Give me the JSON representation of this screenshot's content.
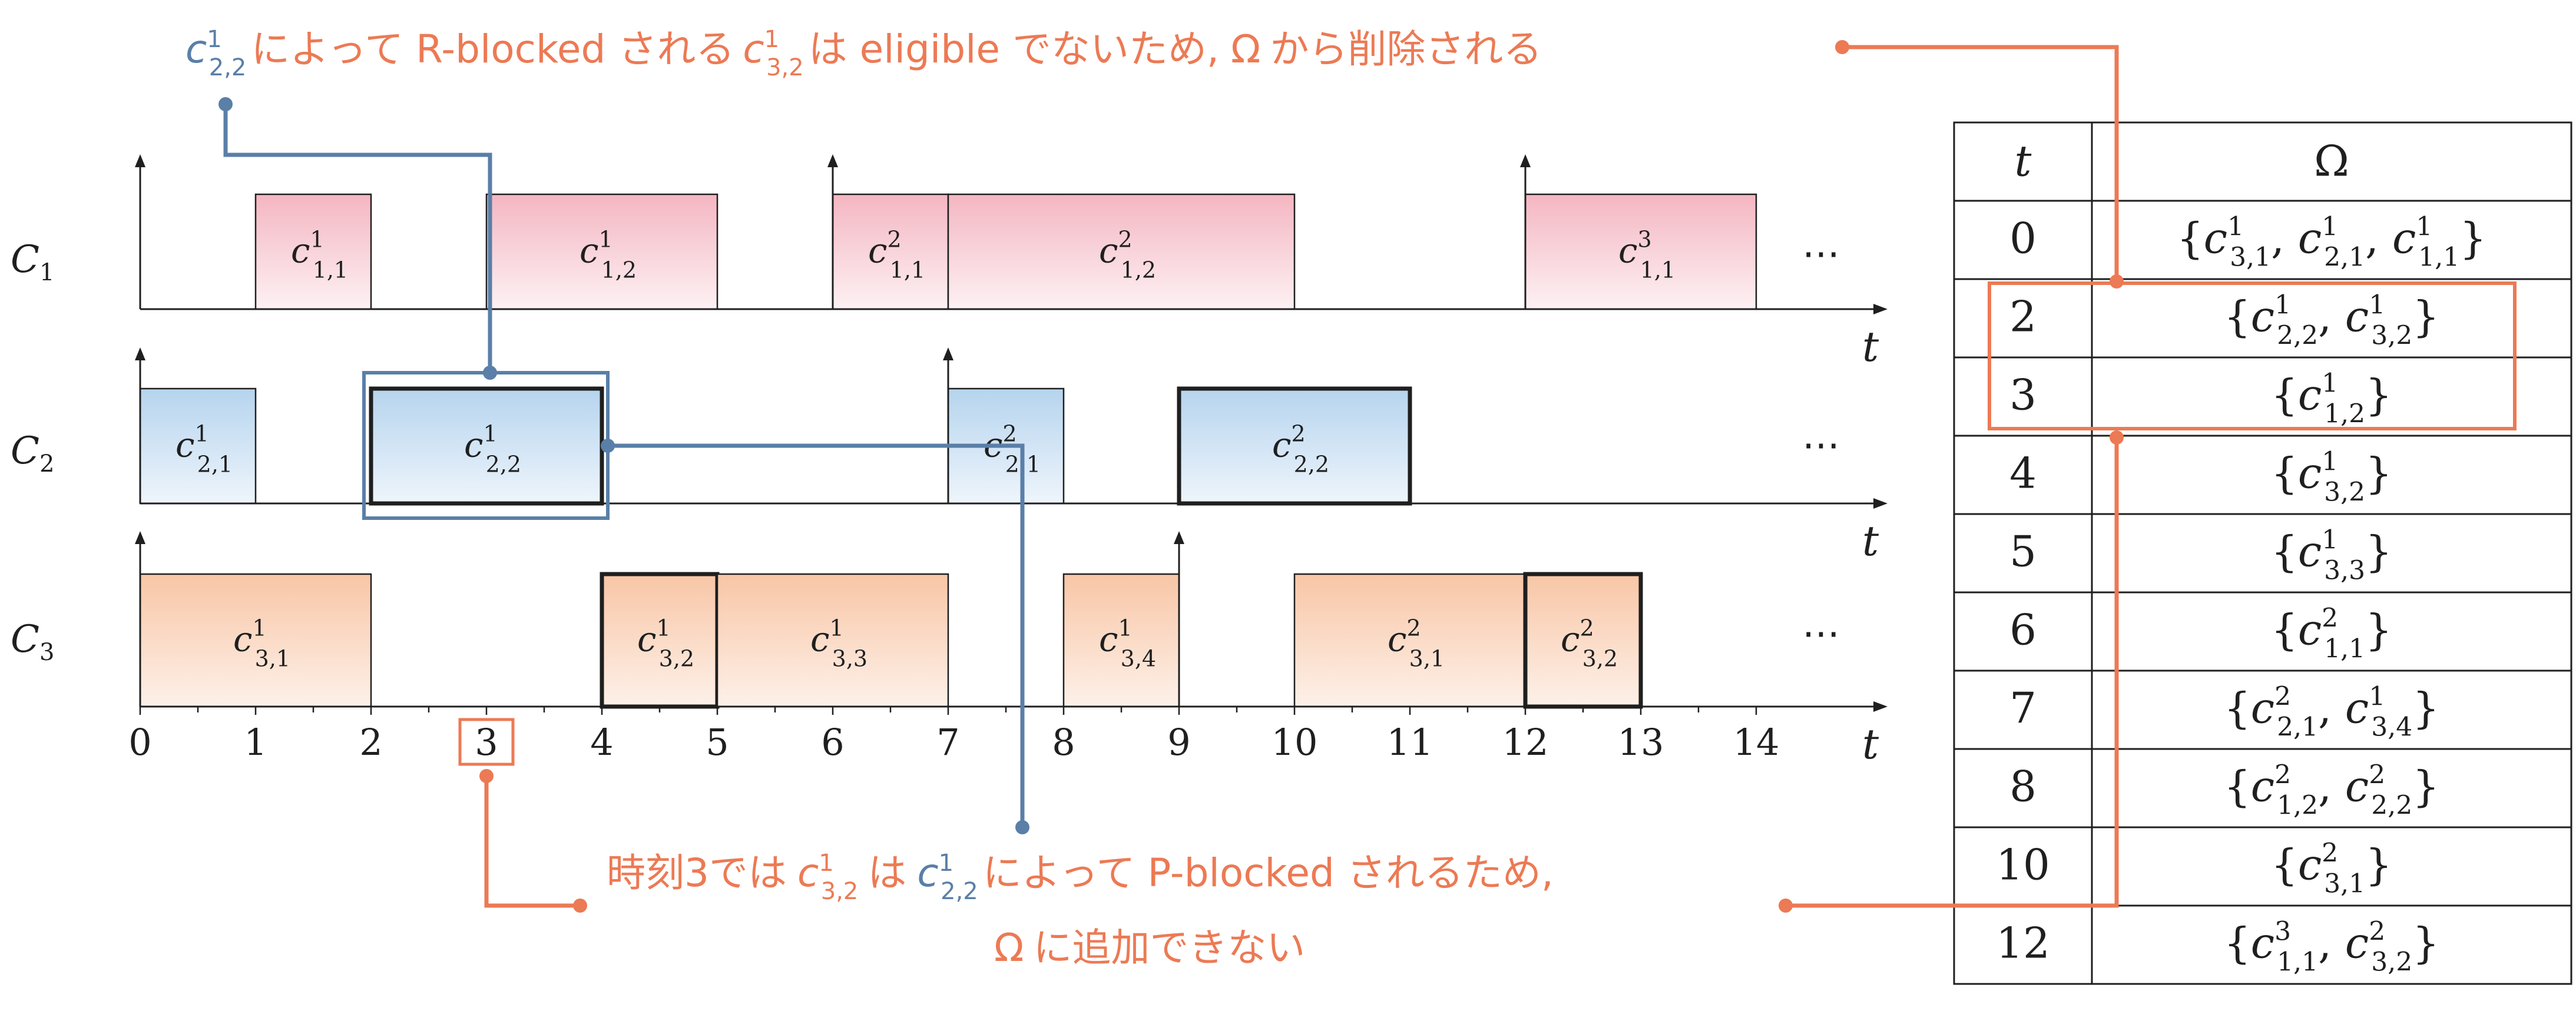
{
  "colors": {
    "orange": "#ec7a54",
    "blue": "#5a7fa8",
    "c1_fill_top": "#f4b6c2",
    "c1_fill_bottom": "#fdf1f3",
    "c2_fill_top": "#b6d4ee",
    "c2_fill_bottom": "#eef5fc",
    "c3_fill_top": "#f8c6a6",
    "c3_fill_bottom": "#fdf1e9",
    "ink": "#1f1f1f"
  },
  "rows": [
    {
      "label": "C",
      "index": "1",
      "jobs": [
        {
          "start": 1,
          "end": 2,
          "bold": false,
          "base": "c",
          "sup": "1",
          "sub": "1,1"
        },
        {
          "start": 3,
          "end": 5,
          "bold": false,
          "base": "c",
          "sup": "1",
          "sub": "1,2"
        },
        {
          "start": 6,
          "end": 7,
          "bold": false,
          "base": "c",
          "sup": "2",
          "sub": "1,1"
        },
        {
          "start": 7,
          "end": 10,
          "bold": false,
          "base": "c",
          "sup": "2",
          "sub": "1,2"
        },
        {
          "start": 12,
          "end": 14,
          "bold": false,
          "base": "c",
          "sup": "3",
          "sub": "1,1"
        }
      ],
      "arrivals": [
        0,
        6,
        12
      ]
    },
    {
      "label": "C",
      "index": "2",
      "jobs": [
        {
          "start": 0,
          "end": 1,
          "bold": false,
          "base": "c",
          "sup": "1",
          "sub": "2,1"
        },
        {
          "start": 2,
          "end": 4,
          "bold": true,
          "base": "c",
          "sup": "1",
          "sub": "2,2"
        },
        {
          "start": 7,
          "end": 8,
          "bold": false,
          "base": "c",
          "sup": "2",
          "sub": "2,1"
        },
        {
          "start": 9,
          "end": 11,
          "bold": true,
          "base": "c",
          "sup": "2",
          "sub": "2,2"
        }
      ],
      "arrivals": [
        0,
        7
      ]
    },
    {
      "label": "C",
      "index": "3",
      "jobs": [
        {
          "start": 0,
          "end": 2,
          "bold": false,
          "base": "c",
          "sup": "1",
          "sub": "3,1"
        },
        {
          "start": 4,
          "end": 5,
          "bold": true,
          "base": "c",
          "sup": "1",
          "sub": "3,2"
        },
        {
          "start": 5,
          "end": 7,
          "bold": false,
          "base": "c",
          "sup": "1",
          "sub": "3,3"
        },
        {
          "start": 8,
          "end": 9,
          "bold": false,
          "base": "c",
          "sup": "1",
          "sub": "3,4"
        },
        {
          "start": 10,
          "end": 12,
          "bold": false,
          "base": "c",
          "sup": "2",
          "sub": "3,1"
        },
        {
          "start": 12,
          "end": 13,
          "bold": true,
          "base": "c",
          "sup": "2",
          "sub": "3,2"
        }
      ],
      "arrivals": [
        0,
        9
      ]
    }
  ],
  "axis": {
    "var": "t",
    "ticks": [
      "0",
      "1",
      "2",
      "3",
      "4",
      "5",
      "6",
      "7",
      "8",
      "9",
      "10",
      "11",
      "12",
      "13",
      "14"
    ],
    "ellipsis": "⋯",
    "highlighted_tick": "3"
  },
  "annotations": {
    "top": {
      "pre_base": "c",
      "pre_sup": "1",
      "pre_sub": "2,2",
      "text1": "によって R-blocked される",
      "mid_base": "c",
      "mid_sup": "1",
      "mid_sub": "3,2",
      "text2": "は eligible でないため,",
      "omega": "Ω",
      "text3": "から削除される"
    },
    "bottom": {
      "line1_pre": "時刻3では",
      "a_base": "c",
      "a_sup": "1",
      "a_sub": "3,2",
      "line1_mid": "は",
      "b_base": "c",
      "b_sup": "1",
      "b_sub": "2,2",
      "line1_post": "によって P-blocked されるため,",
      "omega": "Ω",
      "line2_post": "に追加できない"
    }
  },
  "table": {
    "headers": [
      "t",
      "Ω"
    ],
    "rows": [
      {
        "t": "0",
        "omega": "{c¹₃,₁, c¹₂,₁, c¹₁,₁}",
        "terms": [
          {
            "sup": "1",
            "sub": "3,1"
          },
          {
            "sup": "1",
            "sub": "2,1"
          },
          {
            "sup": "1",
            "sub": "1,1"
          }
        ]
      },
      {
        "t": "2",
        "omega": "{c¹₂,₂, c¹₃,₂}",
        "terms": [
          {
            "sup": "1",
            "sub": "2,2"
          },
          {
            "sup": "1",
            "sub": "3,2"
          }
        ]
      },
      {
        "t": "3",
        "omega": "{c¹₁,₂}",
        "terms": [
          {
            "sup": "1",
            "sub": "1,2"
          }
        ]
      },
      {
        "t": "4",
        "omega": "{c¹₃,₂}",
        "terms": [
          {
            "sup": "1",
            "sub": "3,2"
          }
        ]
      },
      {
        "t": "5",
        "omega": "{c¹₃,₃}",
        "terms": [
          {
            "sup": "1",
            "sub": "3,3"
          }
        ]
      },
      {
        "t": "6",
        "omega": "{c²₁,₁}",
        "terms": [
          {
            "sup": "2",
            "sub": "1,1"
          }
        ]
      },
      {
        "t": "7",
        "omega": "{c²₂,₁, c¹₃,₄}",
        "terms": [
          {
            "sup": "2",
            "sub": "2,1"
          },
          {
            "sup": "1",
            "sub": "3,4"
          }
        ]
      },
      {
        "t": "8",
        "omega": "{c²₁,₂, c²₂,₂}",
        "terms": [
          {
            "sup": "2",
            "sub": "1,2"
          },
          {
            "sup": "2",
            "sub": "2,2"
          }
        ]
      },
      {
        "t": "10",
        "omega": "{c²₃,₁}",
        "terms": [
          {
            "sup": "2",
            "sub": "3,1"
          }
        ]
      },
      {
        "t": "12",
        "omega": "{c³₁,₁, c²₃,₂}",
        "terms": [
          {
            "sup": "3",
            "sub": "1,1"
          },
          {
            "sup": "2",
            "sub": "3,2"
          }
        ]
      }
    ]
  }
}
